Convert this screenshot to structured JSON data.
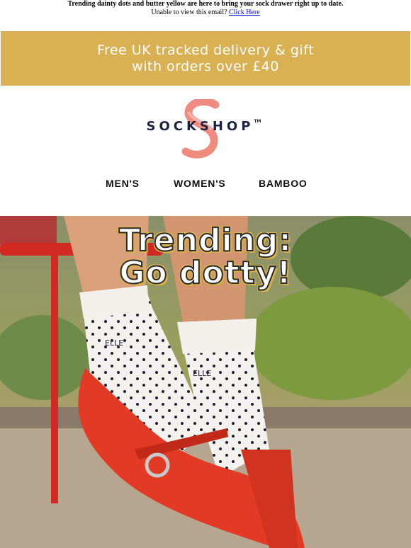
{
  "preheader": {
    "headline": "Trending dainty dots and butter yellow are here to bring your sock drawer right up to date.",
    "unable_text": "Unable to view this email?",
    "click_link": "Click Here"
  },
  "banner": {
    "line1": "Free UK tracked delivery & gift",
    "line2": "with orders over £40",
    "color": "#dab152"
  },
  "logo": {
    "text": "SOCKSHOP",
    "tm": "TM",
    "brand_color": "#1f2143",
    "accent_color": "#f08c7f"
  },
  "nav": {
    "items": [
      "MEN'S",
      "WOMEN'S",
      "BAMBOO"
    ]
  },
  "hero": {
    "title_line1": "Trending:",
    "title_line2": "Go dotty!",
    "sock_brand": "ELLE",
    "sock_brand_2": "ELLE"
  }
}
